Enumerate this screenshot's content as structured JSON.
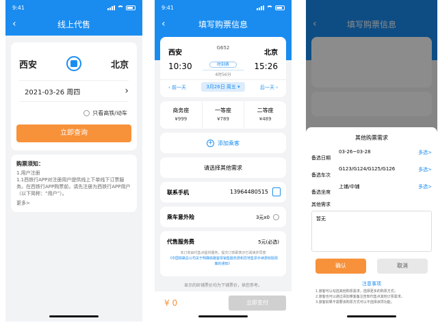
{
  "s1": {
    "time": "9:41",
    "title": "线上代售",
    "from": "西安",
    "to": "北京",
    "date": "2021-03-26 周四",
    "only_highspeed": "只看高铁/动车",
    "query_btn": "立即查询",
    "notice_title": "购票须知：",
    "notice_sub": "1.用户注册",
    "notice_text": "1.1西铁行APP对注册用户提供线上下单线下订票服务。在西铁行APP购票前，请先注册为西铁行APP用户（以下简称：“用户”）。",
    "more": "更多>"
  },
  "s2": {
    "time": "9:41",
    "title": "填写购票信息",
    "from": "西安",
    "to": "北京",
    "train": "G652",
    "dep_time": "10:30",
    "arr_time": "15:26",
    "schedule": "时刻表",
    "duration": "4时56分",
    "prev_day": "前一天",
    "date_chip": "3月26日 周五",
    "next_day": "后一天",
    "seats": [
      {
        "name": "商务座",
        "price": "¥999"
      },
      {
        "name": "一等座",
        "price": "¥789"
      },
      {
        "name": "二等座",
        "price": "¥489"
      }
    ],
    "add_passenger": "添加乘客",
    "other_req": "请选择其他需求",
    "phone_label": "联系手机",
    "phone_value": "13964480515",
    "insurance_label": "乘车意外险",
    "insurance_value": "3元x0",
    "fee_label": "代售服务费",
    "fee_value": "5元(必选)",
    "fee_note": "本订单由代售点提供服务，提交订单即表示已阅读并同意",
    "fee_link": "《中国铁路总公司关于明确铁路客票销售服务费和异地售票手续费收取政策的通知》",
    "bottom_note": "显示的卧铺票价均为下铺票价，供您参考。",
    "total": "¥ 0",
    "pay_btn": "立即支付"
  },
  "s3": {
    "title": "填写购票信息",
    "sheet_title": "其他购票需求",
    "rows": [
      {
        "label": "备选日期",
        "value": "03-26~03-28",
        "action": "多选>"
      },
      {
        "label": "备选车次",
        "value": "G123/G124/G125/G126",
        "action": "多选>"
      },
      {
        "label": "备选坐席",
        "value": "上铺/中铺",
        "action": "多选>"
      }
    ],
    "other_label": "其他需求",
    "other_value": "暂无",
    "confirm": "确认",
    "cancel": "取消",
    "notes_title": "注意事项",
    "notes": [
      "1.旅客可以勾选其他购票需求，选择更多的购票方式；",
      "2.旅客也可以通过添加乘客备注告知代售点其他订票需求。",
      "3.旅客如果不需要该购票方式可以不选择该项功能。"
    ]
  }
}
